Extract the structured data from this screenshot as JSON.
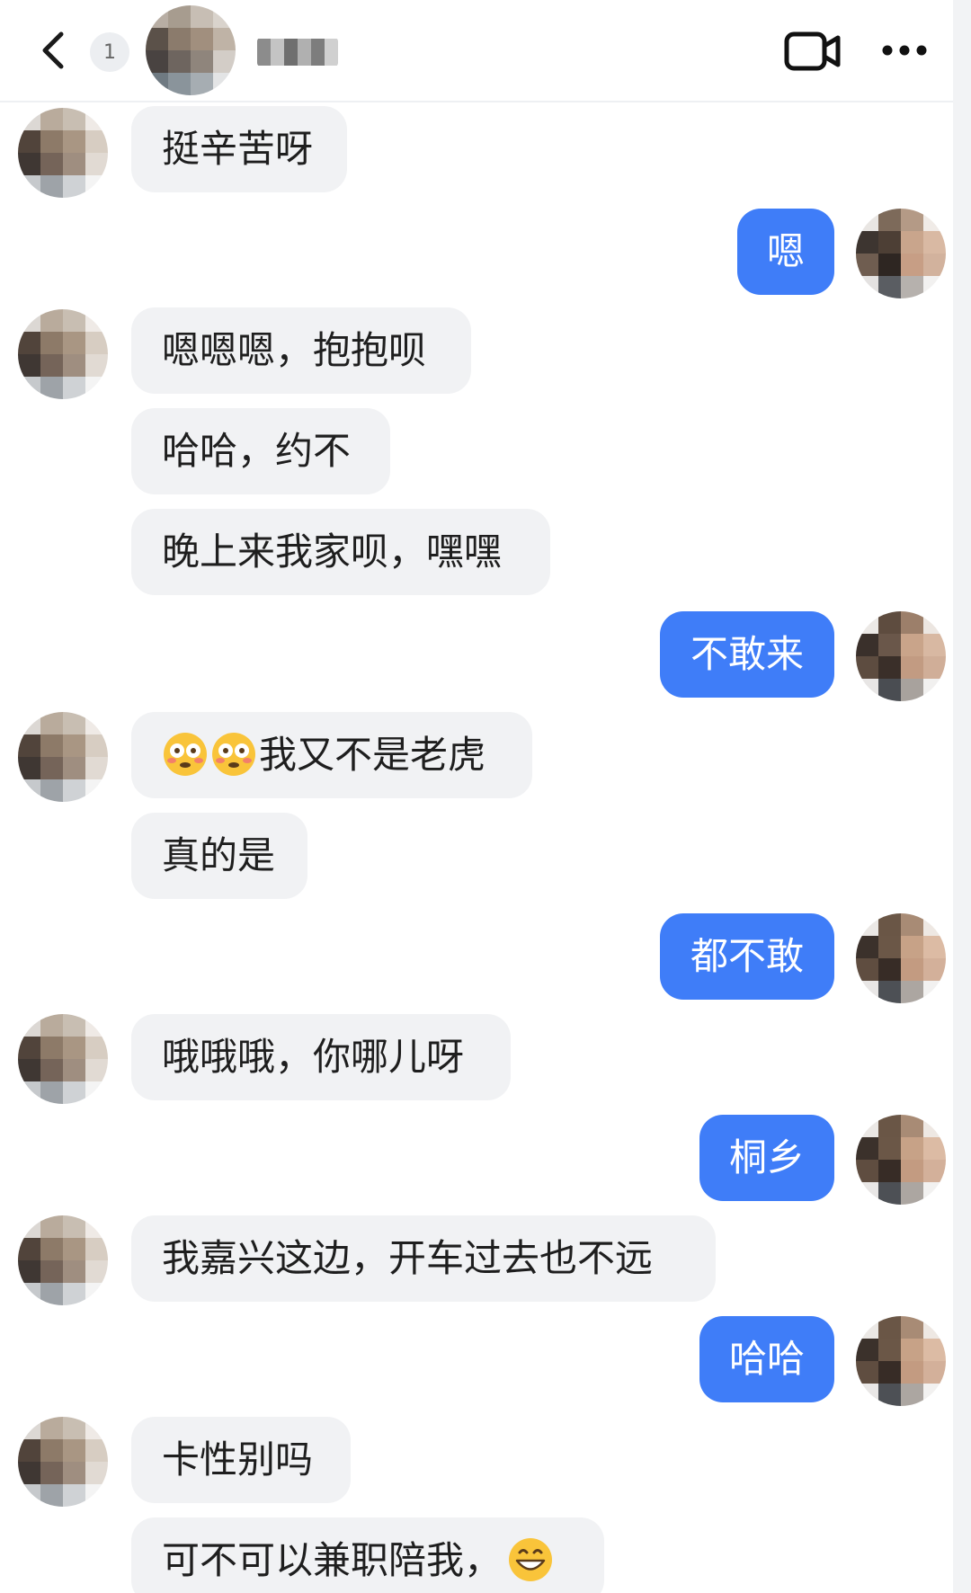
{
  "header": {
    "back_icon": "chevron-left-icon",
    "badge_text": "1",
    "video_icon": "video-camera-icon",
    "more_icon": "more-horizontal-icon"
  },
  "messages": [
    {
      "side": "in",
      "text": "挺辛苦呀"
    },
    {
      "side": "out",
      "text": "嗯"
    },
    {
      "side": "in",
      "text": "嗯嗯嗯，抱抱呗"
    },
    {
      "side": "in",
      "text": "哈哈，约不"
    },
    {
      "side": "in",
      "text": "晚上来我家呗，嘿嘿"
    },
    {
      "side": "out",
      "text": "不敢来"
    },
    {
      "side": "in",
      "text": "我又不是老虎",
      "emoji": "flushed-face-emoji x2"
    },
    {
      "side": "in",
      "text": "真的是"
    },
    {
      "side": "out",
      "text": "都不敢"
    },
    {
      "side": "in",
      "text": "哦哦哦，你哪儿呀"
    },
    {
      "side": "out",
      "text": "桐乡"
    },
    {
      "side": "in",
      "text": "我嘉兴这边，开车过去也不远"
    },
    {
      "side": "out",
      "text": "哈哈"
    },
    {
      "side": "in",
      "text": "卡性别吗"
    },
    {
      "side": "in",
      "text": "可不可以兼职陪我，",
      "emoji": "grinning-face-emoji"
    }
  ],
  "colors": {
    "outgoing_bubble": "#3f7df8",
    "incoming_bubble": "#f1f2f4",
    "incoming_text": "#1e1e1e",
    "outgoing_text": "#ffffff"
  }
}
